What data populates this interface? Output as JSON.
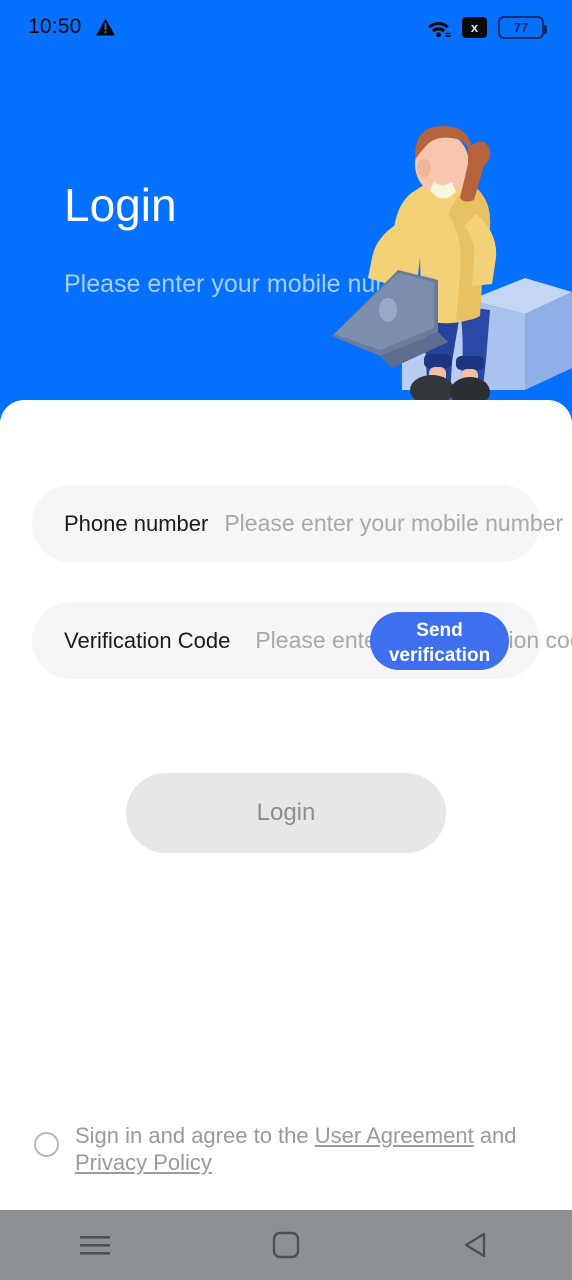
{
  "statusbar": {
    "time": "10:50",
    "warning_icon": "warning-triangle-icon",
    "wifi_icon": "wifi-icon",
    "x_badge_label": "x",
    "battery_level": "77"
  },
  "hero": {
    "title": "Login",
    "subtitle": "Please enter your mobile number",
    "background_color": "#0670ff",
    "illustration": "person-with-laptop-illustration"
  },
  "form": {
    "phone": {
      "label": "Phone number",
      "placeholder": "Please enter your mobile number"
    },
    "code": {
      "label": "Verification Code",
      "placeholder": "Please enter the verification code",
      "send_button_label": "Send verification code",
      "send_button_color": "#3d6fee"
    },
    "submit": {
      "label": "Login",
      "background_color": "#e7e7e7",
      "text_color": "#8e8e8e"
    }
  },
  "agreement": {
    "checked": false,
    "prefix": "Sign in and agree to the ",
    "user_agreement": "User Agreement",
    "conjunction": " and ",
    "privacy_policy": "Privacy Policy"
  },
  "navbar": {
    "recents": "recents-icon",
    "home": "home-icon",
    "back": "back-icon",
    "background_color": "#8c9193"
  }
}
